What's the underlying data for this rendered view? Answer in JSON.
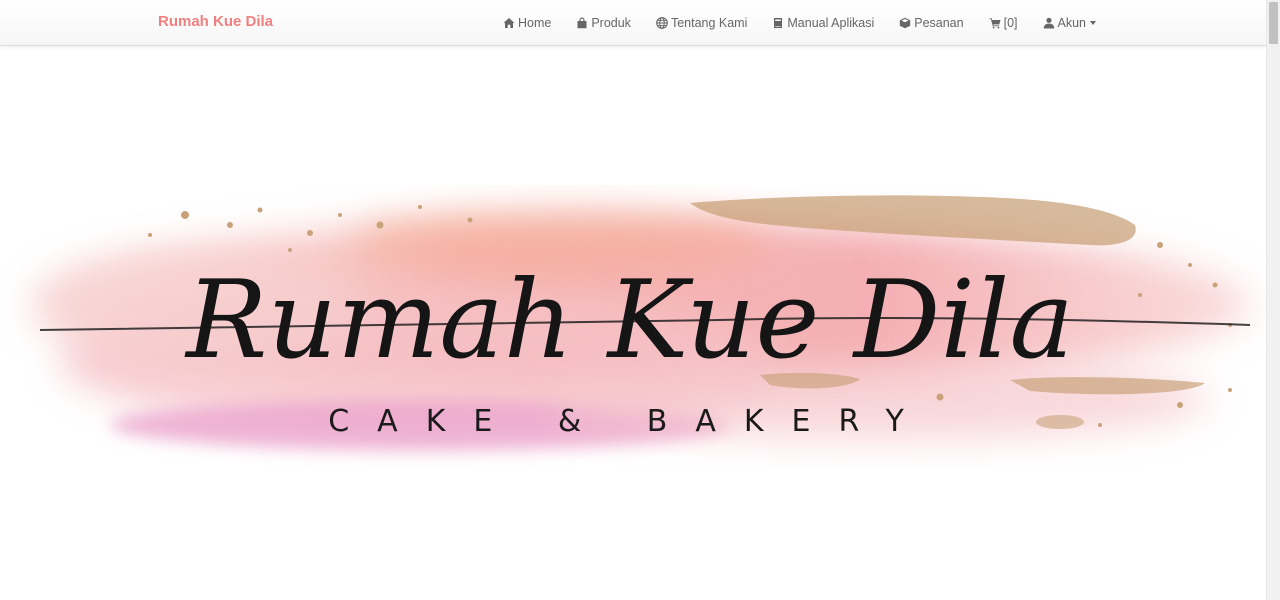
{
  "navbar": {
    "brand": "Rumah Kue Dila",
    "items": [
      {
        "label": "Home",
        "icon": "home-icon"
      },
      {
        "label": "Produk",
        "icon": "shopping-bag-icon"
      },
      {
        "label": "Tentang Kami",
        "icon": "globe-icon"
      },
      {
        "label": "Manual Aplikasi",
        "icon": "book-icon"
      },
      {
        "label": "Pesanan",
        "icon": "box-icon"
      },
      {
        "label": "[0]",
        "icon": "cart-icon"
      },
      {
        "label": "Akun",
        "icon": "user-icon"
      }
    ]
  },
  "hero": {
    "logo_title": "Rumah Kue Dila",
    "logo_subtitle": "CAKE & BAKERY"
  },
  "colors": {
    "brand": "#f08080",
    "nav_text": "#666666",
    "watercolor_pink": "#f5b5b8",
    "watercolor_magenta": "#e99bc9",
    "gold": "#c9a27a"
  }
}
